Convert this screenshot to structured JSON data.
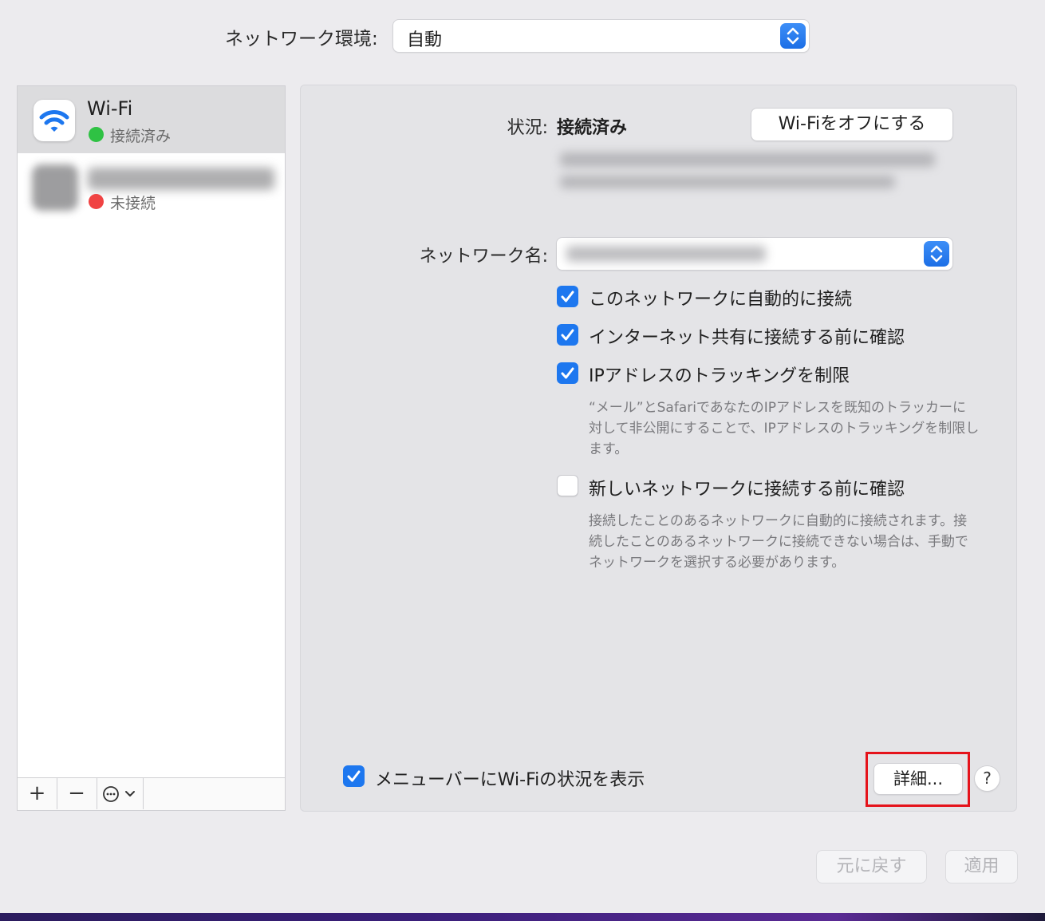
{
  "location": {
    "label": "ネットワーク環境:",
    "value": "自動"
  },
  "sidebar": {
    "services": [
      {
        "name": "Wi-Fi",
        "status": "接続済み",
        "status_color": "#2fc244",
        "icon": "wifi-icon"
      },
      {
        "name": "",
        "status": "未接続",
        "status_color": "#f04343",
        "icon": "thunderbolt-bridge-icon"
      }
    ],
    "toolbar": {
      "add": "+",
      "remove": "−"
    }
  },
  "panel": {
    "status_label": "状況:",
    "status_value": "接続済み",
    "wifi_off_button": "Wi-Fiをオフにする",
    "network_name_label": "ネットワーク名:",
    "options": [
      {
        "label": "このネットワークに自動的に接続",
        "checked": true
      },
      {
        "label": "インターネット共有に接続する前に確認",
        "checked": true
      },
      {
        "label": "IPアドレスのトラッキングを制限",
        "checked": true,
        "description": "“メール”とSafariであなたのIPアドレスを既知のトラッカーに対して非公開にすることで、IPアドレスのトラッキングを制限します。"
      },
      {
        "label": "新しいネットワークに接続する前に確認",
        "checked": false,
        "description": "接続したことのあるネットワークに自動的に接続されます。接続したことのあるネットワークに接続できない場合は、手動でネットワークを選択する必要があります。"
      }
    ],
    "menubar_option": {
      "label": "メニューバーにWi-Fiの状況を表示",
      "checked": true
    },
    "details_button": "詳細...",
    "help_button": "?"
  },
  "footer": {
    "revert_button": "元に戻す",
    "apply_button": "適用"
  },
  "colors": {
    "accent": "#1d77ef",
    "highlight": "#e5131b"
  }
}
